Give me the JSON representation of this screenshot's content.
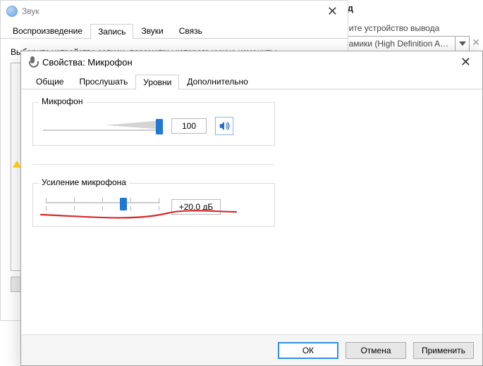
{
  "output_pane": {
    "heading": "ывод",
    "select_label": "ыберите устройство вывода",
    "selected_device": "Динамики (High Definition Audio..."
  },
  "sound_dialog": {
    "title": "Звук",
    "tabs": [
      "Воспроизведение",
      "Запись",
      "Звуки",
      "Связь"
    ],
    "active_tab_index": 1,
    "instruction": "Выберите устройство записи, параметры которого нужно изменить:"
  },
  "props_dialog": {
    "title": "Свойства: Микрофон",
    "tabs": [
      "Общие",
      "Прослушать",
      "Уровни",
      "Дополнительно"
    ],
    "active_tab_index": 2,
    "mic_group": {
      "heading": "Микрофон",
      "level_text": "100",
      "level_percent": 100
    },
    "boost_group": {
      "heading": "Усиление микрофона",
      "value_text": "+20.0 дБ",
      "percent": 67
    },
    "buttons": {
      "ok": "ОК",
      "cancel": "Отмена",
      "apply": "Применить"
    }
  }
}
